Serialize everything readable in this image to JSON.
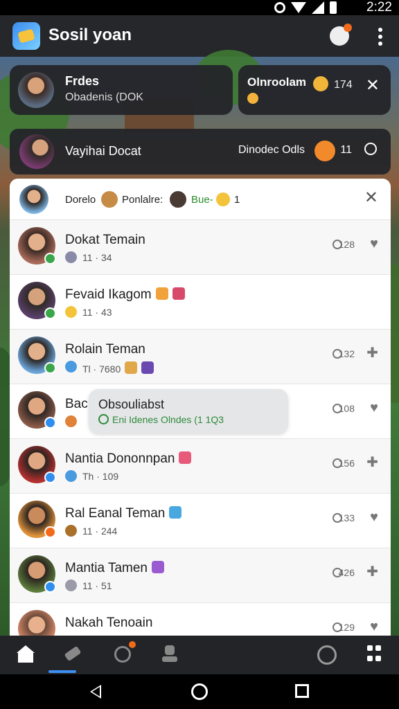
{
  "status_bar": {
    "time": "2:22"
  },
  "app_bar": {
    "title": "Sosil yoan"
  },
  "feed_card": {
    "title": "Frdes",
    "subtitle": "Obadenis (DOK"
  },
  "promo_card": {
    "title": "Olnroolam",
    "count": "174"
  },
  "chat_card": {
    "name": "Vayihai Docat",
    "status": "Dinodec Odls",
    "count": "11"
  },
  "panel_header": {
    "label1": "Dorelo",
    "label2": "Ponlalre:",
    "label3": "Bue-",
    "label4": "1"
  },
  "friends": [
    {
      "name": "Dokat Temain",
      "sub": "11 · 34",
      "score": "128",
      "badge_color": "#3aa64a",
      "avatar_color": "#a86a5a"
    },
    {
      "name": "Fevaid Ikagom",
      "sub": "11 · 43",
      "score": "",
      "badge_color": "#3aa64a",
      "avatar_color": "#5a3f6a"
    },
    {
      "name": "Rolain Teman",
      "sub": "Tl · 7680",
      "score": "132",
      "badge_color": "#3aa64a",
      "avatar_color": "#6aa4d8"
    },
    {
      "name": "Bac",
      "sub": "",
      "score": "108",
      "badge_color": "#2f8ef0",
      "avatar_color": "#8a5a48"
    },
    {
      "name": "Nantia Dononnpan",
      "sub": "Th · 109",
      "score": "156",
      "badge_color": "#2f8ef0",
      "avatar_color": "#b3302f"
    },
    {
      "name": "Ral Eanal Teman",
      "sub": "11 · 244",
      "score": "133",
      "badge_color": "#f26a1b",
      "avatar_color": "#e0923a"
    },
    {
      "name": "Mantia Tamen",
      "sub": "11 · 51",
      "score": "426",
      "badge_color": "#2f8ef0",
      "avatar_color": "#5a7a3a"
    },
    {
      "name": "Nakah Tenoain",
      "sub": "",
      "score": "129",
      "badge_color": "#f26a1b",
      "avatar_color": "#d98a6a"
    }
  ],
  "tooltip": {
    "title": "Obsouliabst",
    "subtitle": "Eni Idenes Olndes (1 1Q3"
  },
  "icons": [
    "notification-icon",
    "more-icon",
    "close-icon",
    "search-icon",
    "home-icon",
    "share-icon",
    "profile-icon",
    "media-icon",
    "grid-icon"
  ],
  "colors": {
    "accent": "#3e8ef5",
    "online": "#3aa64a",
    "alert": "#f26a1b"
  }
}
